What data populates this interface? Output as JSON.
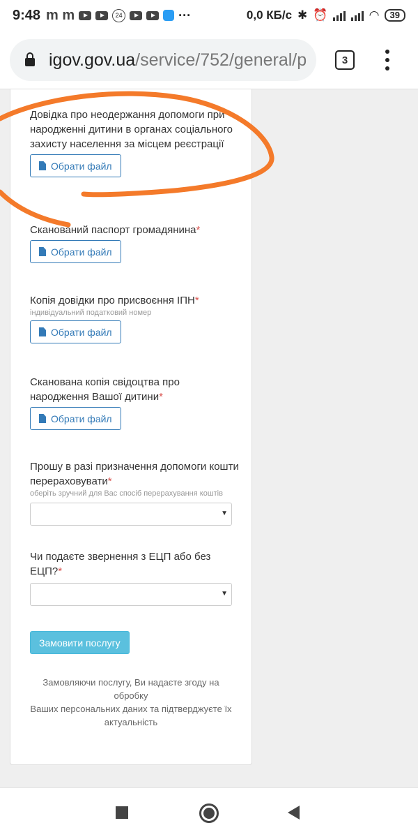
{
  "status_bar": {
    "time": "9:48",
    "notif_letters": "m m",
    "badge_24": "24",
    "more": "···",
    "net_speed": "0,0 КБ/с",
    "battery": "39"
  },
  "browser": {
    "url_domain": "igov.gov.ua",
    "url_path": "/service/752/general/p",
    "tab_count": "3"
  },
  "form": {
    "fields": [
      {
        "label": "Довідка про неодержання допомоги при народженні дитини в органах соціального захисту населення за місцем реєстрації",
        "required": "",
        "hint": "",
        "button": "Обрати файл"
      },
      {
        "label": "Сканований паспорт громадянина",
        "required": "*",
        "hint": "",
        "button": "Обрати файл"
      },
      {
        "label": "Копія довідки про присвоєння ІПН",
        "required": "*",
        "hint": "індивідуальний податковий номер",
        "button": "Обрати файл"
      },
      {
        "label": "Сканована копія свідоцтва про народження Вашої дитини",
        "required": "*",
        "hint": "",
        "button": "Обрати файл"
      }
    ],
    "selects": [
      {
        "label": "Прошу в разі призначення допомоги кошти перераховувати",
        "required": "*",
        "hint": "оберіть зручний для Вас спосіб перерахування коштів",
        "value": ""
      },
      {
        "label": "Чи подаєте звернення з ЕЦП або без ЕЦП?",
        "required": "*",
        "hint": "",
        "value": ""
      }
    ],
    "submit_label": "Замовити послугу",
    "consent_line1": "Замовляючи послугу, Ви надаєте згоду на обробку",
    "consent_line2": "Ваших персональних даних та підтверджуєте їх актуальність"
  },
  "colors": {
    "link_blue": "#337ab7",
    "submit_bg": "#5bc0de",
    "required_red": "#d9534f",
    "annotation_orange": "#f47a2a"
  },
  "icons": [
    "file-icon",
    "lock-icon",
    "stop-icon",
    "home-icon",
    "back-icon",
    "menu-icon"
  ]
}
